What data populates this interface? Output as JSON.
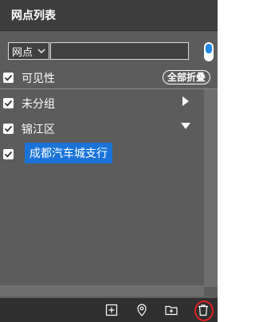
{
  "panel": {
    "title": "网点列表"
  },
  "filter": {
    "type_value": "网点",
    "search_value": "",
    "search_placeholder": ""
  },
  "visibility": {
    "label": "可见性",
    "collapse_all_label": "全部折叠"
  },
  "tree": {
    "items": [
      {
        "label": "未分组",
        "checked": true,
        "expanded": false
      },
      {
        "label": "锦江区",
        "checked": true,
        "expanded": true
      },
      {
        "label": "成都汽车城支行",
        "checked": true,
        "selected": true
      }
    ]
  },
  "colors": {
    "panel_bg": "#5c5c5c",
    "header_bg": "#3d3d3d",
    "toolbar_bg": "#2f2f2f",
    "selection": "#1a73d9",
    "toggle_accent": "#1e88e5",
    "delete_highlight": "#e02020"
  },
  "icons": {
    "chevron": "chevron-down-icon",
    "add": "add-square-icon",
    "locate": "location-pin-icon",
    "folder": "folder-add-icon",
    "delete": "trash-icon"
  }
}
